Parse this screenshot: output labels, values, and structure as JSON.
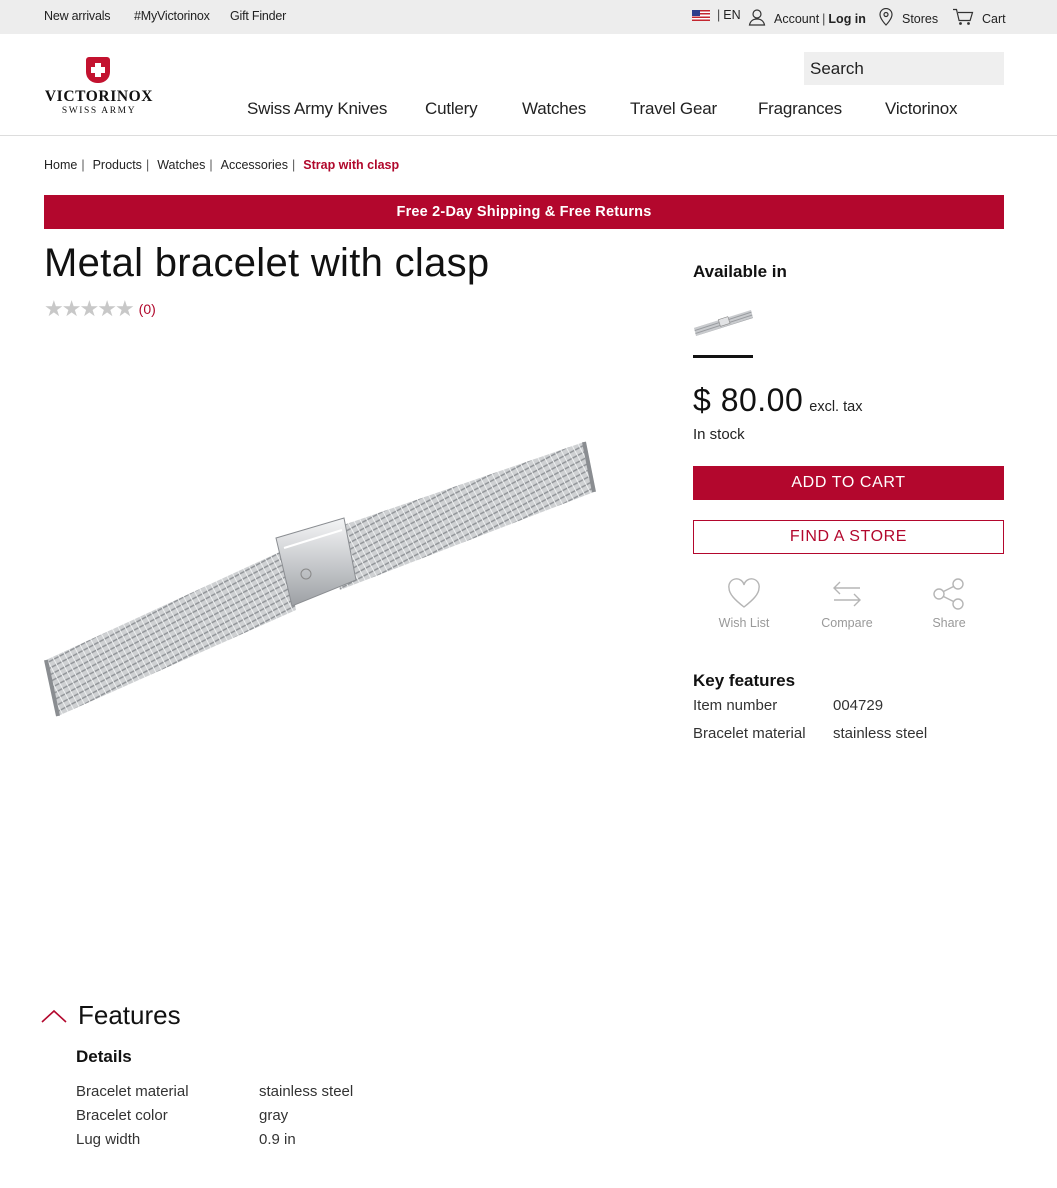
{
  "topbar": {
    "left_links": [
      "New arrivals",
      "#MyVictorinox",
      "Gift Finder"
    ],
    "language": "EN",
    "account_label": "Account",
    "login_label": "Log in",
    "stores_label": "Stores",
    "cart_label": "Cart"
  },
  "header": {
    "logo_brand": "VICTORINOX",
    "logo_sub": "SWISS ARMY",
    "search_placeholder": "Search",
    "nav": [
      "Swiss Army Knives",
      "Cutlery",
      "Watches",
      "Travel Gear",
      "Fragrances",
      "Victorinox"
    ]
  },
  "breadcrumb": {
    "items": [
      "Home",
      "Products",
      "Watches",
      "Accessories"
    ],
    "current": "Strap with clasp"
  },
  "promo_banner": "Free 2-Day Shipping & Free Returns",
  "product": {
    "title": "Metal bracelet with clasp",
    "rating": {
      "stars": 0,
      "max": 5,
      "count_label": "(0)"
    },
    "available_in_label": "Available in",
    "price": "$ 80.00",
    "tax_note": "excl. tax",
    "stock_status": "In stock",
    "add_to_cart_label": "ADD TO CART",
    "find_store_label": "FIND A STORE",
    "actions": [
      "Wish List",
      "Compare",
      "Share"
    ],
    "key_features_title": "Key features",
    "key_features": [
      {
        "label": "Item number",
        "value": "004729"
      },
      {
        "label": "Bracelet material",
        "value": "stainless steel"
      }
    ]
  },
  "features_section": {
    "title": "Features",
    "details_title": "Details",
    "rows": [
      {
        "label": "Bracelet material",
        "value": "stainless steel"
      },
      {
        "label": "Bracelet color",
        "value": "gray"
      },
      {
        "label": "Lug width",
        "value": "0.9 in"
      }
    ]
  },
  "colors": {
    "accent": "#b3072d",
    "topbar_bg": "#ededed",
    "search_bg": "#efefef"
  }
}
